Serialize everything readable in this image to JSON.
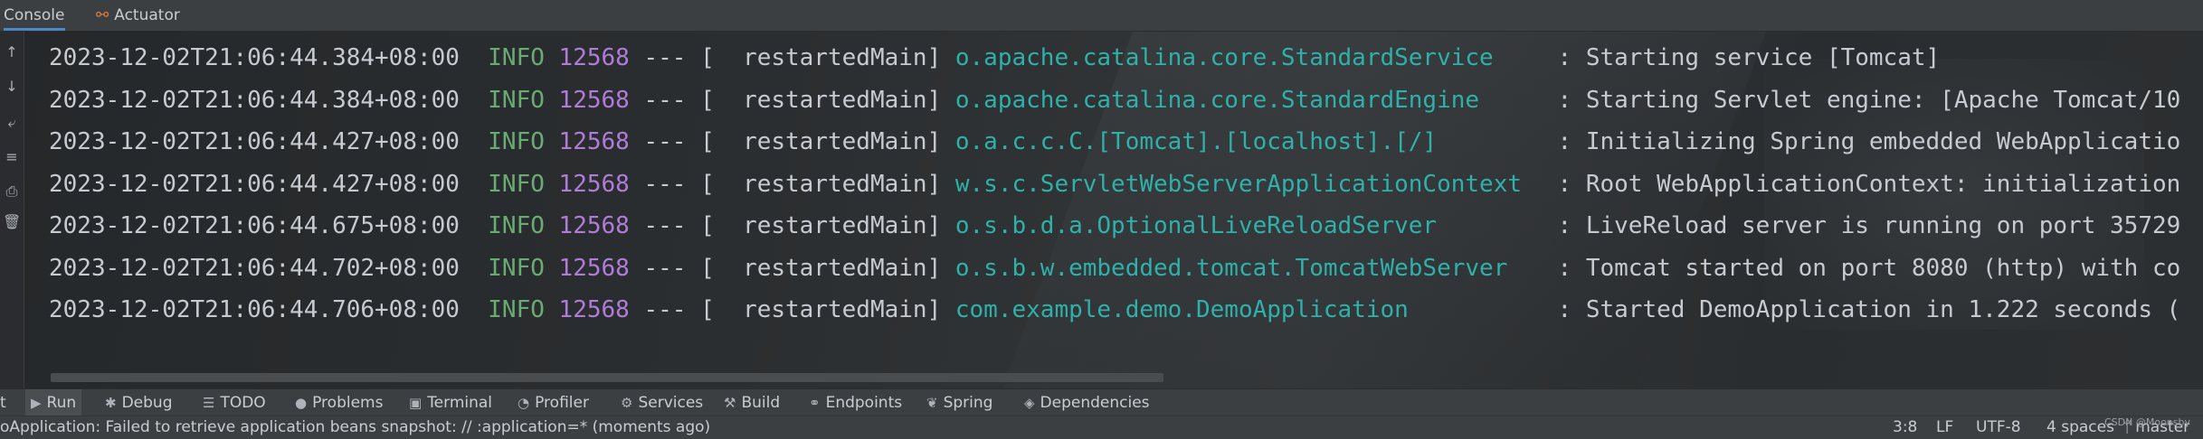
{
  "tabs": [
    {
      "label": "Console",
      "icon": "console-tab"
    },
    {
      "label": "Actuator",
      "icon": "actuator-icon"
    }
  ],
  "gutter_icons": [
    "arrow-up-icon",
    "arrow-down-icon",
    "soft-wrap-icon",
    "scroll-to-end-icon",
    "print-icon",
    "trash-icon"
  ],
  "log_lines": [
    {
      "ts": "2023-12-02T21:06:44.384+08:00",
      "level": "INFO",
      "pid": "12568",
      "sep": "---",
      "thread": "[  restartedMain]",
      "logger": "o.apache.catalina.core.StandardService",
      "msg": ": Starting service [Tomcat]"
    },
    {
      "ts": "2023-12-02T21:06:44.384+08:00",
      "level": "INFO",
      "pid": "12568",
      "sep": "---",
      "thread": "[  restartedMain]",
      "logger": "o.apache.catalina.core.StandardEngine",
      "msg": ": Starting Servlet engine: [Apache Tomcat/10"
    },
    {
      "ts": "2023-12-02T21:06:44.427+08:00",
      "level": "INFO",
      "pid": "12568",
      "sep": "---",
      "thread": "[  restartedMain]",
      "logger": "o.a.c.c.C.[Tomcat].[localhost].[/]",
      "msg": ": Initializing Spring embedded WebApplicatio"
    },
    {
      "ts": "2023-12-02T21:06:44.427+08:00",
      "level": "INFO",
      "pid": "12568",
      "sep": "---",
      "thread": "[  restartedMain]",
      "logger": "w.s.c.ServletWebServerApplicationContext",
      "msg": ": Root WebApplicationContext: initialization"
    },
    {
      "ts": "2023-12-02T21:06:44.675+08:00",
      "level": "INFO",
      "pid": "12568",
      "sep": "---",
      "thread": "[  restartedMain]",
      "logger": "o.s.b.d.a.OptionalLiveReloadServer",
      "msg": ": LiveReload server is running on port 35729"
    },
    {
      "ts": "2023-12-02T21:06:44.702+08:00",
      "level": "INFO",
      "pid": "12568",
      "sep": "---",
      "thread": "[  restartedMain]",
      "logger": "o.s.b.w.embedded.tomcat.TomcatWebServer",
      "msg": ": Tomcat started on port 8080 (http) with co"
    },
    {
      "ts": "2023-12-02T21:06:44.706+08:00",
      "level": "INFO",
      "pid": "12568",
      "sep": "---",
      "thread": "[  restartedMain]",
      "logger": "com.example.demo.DemoApplication",
      "msg": ": Started DemoApplication in 1.222 seconds ("
    }
  ],
  "tool_tabs": [
    {
      "label": "t",
      "icon": ""
    },
    {
      "label": "Run",
      "icon": "run-icon"
    },
    {
      "label": "Debug",
      "icon": "bug-icon"
    },
    {
      "label": "TODO",
      "icon": "list-icon"
    },
    {
      "label": "Problems",
      "icon": "info-icon"
    },
    {
      "label": "Terminal",
      "icon": "terminal-icon"
    },
    {
      "label": "Profiler",
      "icon": "profiler-icon"
    },
    {
      "label": "Services",
      "icon": "services-icon"
    },
    {
      "label": "Build",
      "icon": "hammer-icon"
    },
    {
      "label": "Endpoints",
      "icon": "endpoints-icon"
    },
    {
      "label": "Spring",
      "icon": "spring-leaf-icon"
    },
    {
      "label": "Dependencies",
      "icon": "stack-icon"
    }
  ],
  "status": {
    "message": "oApplication: Failed to retrieve application beans snapshot: // :application=* (moments ago)",
    "position": "3:8",
    "line_sep": "LF",
    "encoding": "UTF-8",
    "indent": "4 spaces",
    "branch": "master",
    "watermark": "CSDN @Moonsby"
  }
}
